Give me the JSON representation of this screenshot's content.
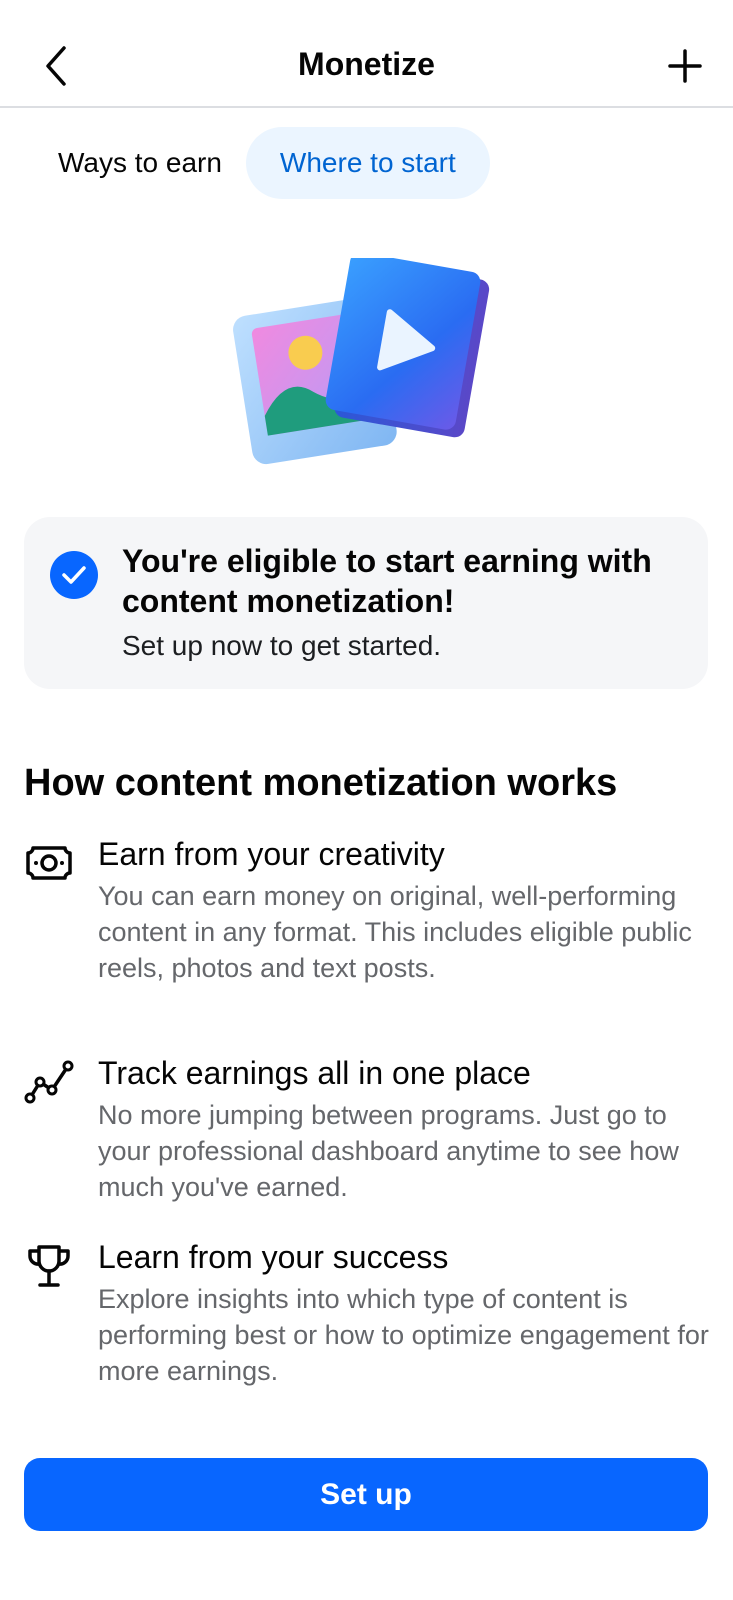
{
  "header": {
    "title": "Monetize",
    "back_icon": "chevron-left-icon",
    "add_icon": "plus-icon"
  },
  "tabs": [
    {
      "label": "Ways to earn",
      "active": false
    },
    {
      "label": "Where to start",
      "active": true
    }
  ],
  "hero": {
    "icon": "photo-video-illustration"
  },
  "eligibility": {
    "icon": "check-circle-icon",
    "title": "You're eligible to start earning with content monetization!",
    "subtitle": "Set up now to get started."
  },
  "section": {
    "heading": "How content monetization works",
    "features": [
      {
        "icon": "money-icon",
        "title": "Earn from your creativity",
        "description": "You can earn money on original, well-performing content in any format. This includes eligible public reels, photos and text posts."
      },
      {
        "icon": "chart-line-icon",
        "title": "Track earnings all in one place",
        "description": "No more jumping between programs. Just go to your professional dashboard anytime to see how much you've earned."
      },
      {
        "icon": "trophy-icon",
        "title": "Learn from your success",
        "description": "Explore insights into which type of content is performing best or how to optimize engagement for more earnings."
      }
    ]
  },
  "cta": {
    "label": "Set up"
  },
  "colors": {
    "accent": "#0866ff",
    "tab_active_bg": "#ebf5ff",
    "tab_active_text": "#0064d1",
    "card_bg": "#f5f6f8",
    "secondary_text": "#65676b"
  }
}
